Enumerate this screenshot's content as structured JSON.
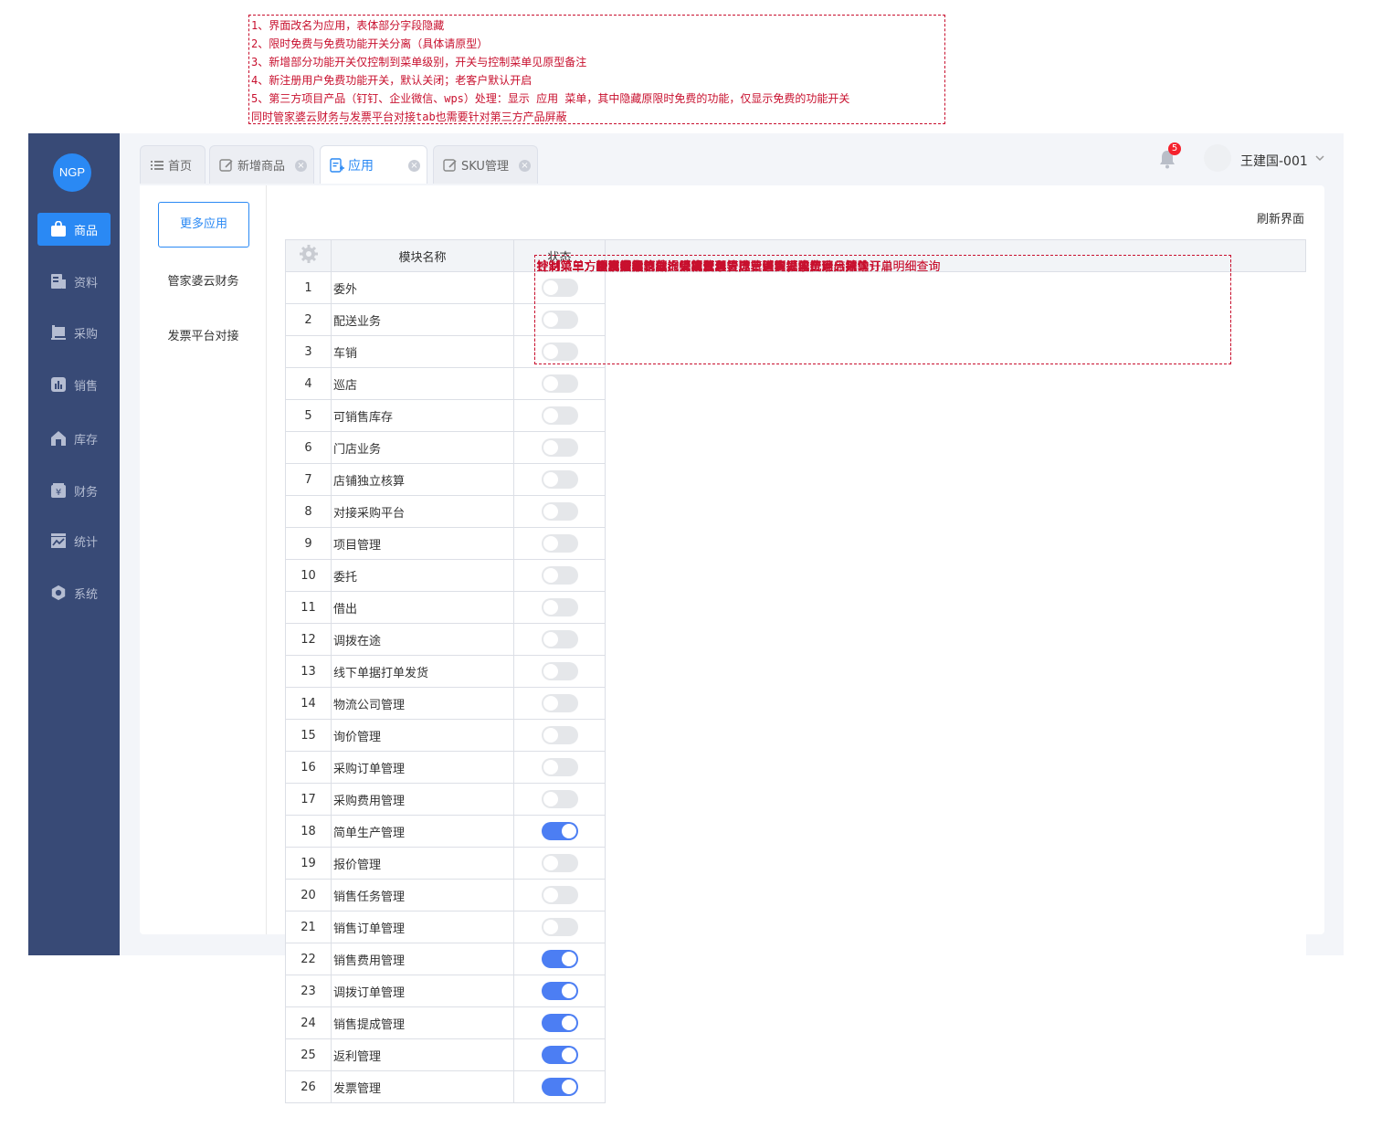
{
  "annotation": [
    "1、界面改名为应用，表体部分字段隐藏",
    "2、限时免费与免费功能开关分离（具体请原型）",
    "3、新增部分功能开关仅控制到菜单级别，开关与控制菜单见原型备注",
    "4、新注册用户免费功能开关，默认关闭；老客户默认开启",
    "5、第三方项目产品（钉钉、企业微信、wps）处理：显示 应用 菜单，其中隐藏原限时免费的功能，仅显示免费的功能开关",
    " 同时管家婆云财务与发票平台对接tab也需要针对第三方产品屏蔽"
  ],
  "logo": "NGP",
  "sidebar": [
    {
      "label": "商品",
      "icon": "bag-icon"
    },
    {
      "label": "资料",
      "icon": "document-icon"
    },
    {
      "label": "采购",
      "icon": "purchase-icon"
    },
    {
      "label": "销售",
      "icon": "chart-icon"
    },
    {
      "label": "库存",
      "icon": "warehouse-icon"
    },
    {
      "label": "财务",
      "icon": "yen-icon"
    },
    {
      "label": "统计",
      "icon": "stats-icon"
    },
    {
      "label": "系统",
      "icon": "gear-icon"
    }
  ],
  "tabs": [
    {
      "label": "首页",
      "icon": "list-icon"
    },
    {
      "label": "新增商品",
      "icon": "edit-icon"
    },
    {
      "label": "应用",
      "icon": "app-icon"
    },
    {
      "label": "SKU管理",
      "icon": "edit-icon"
    }
  ],
  "header": {
    "badge": "5",
    "user": "王建国-001"
  },
  "left_panel": {
    "more_button": "更多应用",
    "links": [
      "管家婆云财务",
      "发票平台对接"
    ]
  },
  "refresh": "刷新界面",
  "table": {
    "headers": [
      "",
      "模块名称",
      "状态",
      ""
    ],
    "rows": [
      {
        "n": "1",
        "name": "委外",
        "on": false,
        "note": "针对第三方项目产品隐藏"
      },
      {
        "n": "2",
        "name": "配送业务",
        "on": false,
        "note": "针对第三方项目产品隐藏"
      },
      {
        "n": "3",
        "name": "车销",
        "on": false,
        "note": "针对第三方项目产品隐藏"
      },
      {
        "n": "4",
        "name": "巡店",
        "on": false,
        "note": "针对第三方项目产品隐藏"
      },
      {
        "n": "5",
        "name": "可销售库存",
        "on": false,
        "note": "针对第三方项目产品隐藏"
      },
      {
        "n": "6",
        "name": "门店业务",
        "on": false,
        "note": "针对第三方项目产品隐藏"
      },
      {
        "n": "7",
        "name": "店铺独立核算",
        "on": false,
        "note": "针对第三方项目产品隐藏"
      },
      {
        "n": "8",
        "name": "对接采购平台",
        "on": false,
        "note": "针对第三方项目产品隐藏"
      },
      {
        "n": "9",
        "name": "项目管理",
        "on": false,
        "note": "针对第三方项目产品隐藏"
      },
      {
        "n": "10",
        "name": "委托",
        "on": false,
        "note": "针对第三方项目产品隐藏"
      },
      {
        "n": "11",
        "name": "借出",
        "on": false,
        "note": "针对第三方项目产品隐藏"
      },
      {
        "n": "12",
        "name": "调拨在途",
        "on": false,
        "note": ""
      },
      {
        "n": "13",
        "name": "线下单据打单发货",
        "on": false,
        "note": ""
      },
      {
        "n": "14",
        "name": "物流公司管理",
        "on": false,
        "note": "控制菜单：物流公司、物流模板管理、运费结算；注：网店默认开启"
      },
      {
        "n": "15",
        "name": "询价管理",
        "on": false,
        "note": "控制菜单：新增询价单、询价单管理"
      },
      {
        "n": "16",
        "name": "采购订单管理",
        "on": false,
        "note": "控制菜单：新增采购订单、采购订单管理、采购订单统计、采购订单明细查询"
      },
      {
        "n": "17",
        "name": "采购费用管理",
        "on": false,
        "note": "控制菜单：采购费用管理、采购费用分摊管理、采购费用分摊单"
      },
      {
        "n": "18",
        "name": "简单生产管理",
        "on": true,
        "note": "控制菜单：生产模板、生产完工单、生产单查询、生产商品统计"
      },
      {
        "n": "19",
        "name": "报价管理",
        "on": false,
        "note": "控制菜单：新增报价单、报价单管理"
      },
      {
        "n": "20",
        "name": "销售任务管理",
        "on": false,
        "note": "控制菜单：销售时段划分、销售任务管理"
      },
      {
        "n": "21",
        "name": "销售订单管理",
        "on": false,
        "note": "控制菜单：新增销售订单、销售订单管理、销售订单统计、销售订单明细查询"
      },
      {
        "n": "22",
        "name": "销售费用管理",
        "on": true,
        "note": "控制菜单：销售费用管理、销售费用分摊管理、销售费用分摊单"
      },
      {
        "n": "23",
        "name": "调拨订单管理",
        "on": true,
        "note": "控制菜单：新增调拨订单、调拨订单管理"
      },
      {
        "n": "24",
        "name": "销售提成管理",
        "on": true,
        "note": "控制菜单：提成方案管理、计算职员提成、历史提成记录"
      },
      {
        "n": "25",
        "name": "返利管理",
        "on": true,
        "note": "控制菜单：返利方案管理、计算返利、历史返利记录"
      },
      {
        "n": "26",
        "name": "发票管理",
        "on": true,
        "note": "控制菜单：开票信息管理、销项发票管理、进项发票管理"
      }
    ]
  },
  "colors": {
    "sidebar": "#384a76",
    "accent": "#2a89f4",
    "note_red": "#c8102e",
    "switch_on": "#4c7ef3"
  }
}
